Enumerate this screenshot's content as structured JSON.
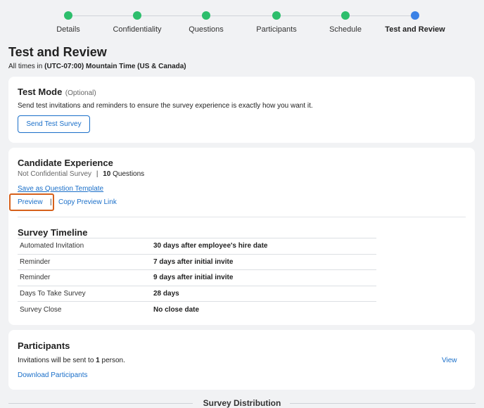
{
  "stepper": {
    "steps": [
      {
        "label": "Details",
        "state": "complete"
      },
      {
        "label": "Confidentiality",
        "state": "complete"
      },
      {
        "label": "Questions",
        "state": "complete"
      },
      {
        "label": "Participants",
        "state": "complete"
      },
      {
        "label": "Schedule",
        "state": "complete"
      },
      {
        "label": "Test and Review",
        "state": "active"
      }
    ]
  },
  "header": {
    "title": "Test and Review",
    "timezone_prefix": "All times in",
    "timezone_value": "(UTC-07:00) Mountain Time (US & Canada)"
  },
  "test_mode": {
    "title": "Test Mode",
    "optional": "(Optional)",
    "description": "Send test invitations and reminders to ensure the survey experience is exactly how you want it.",
    "button": "Send Test Survey"
  },
  "candidate_experience": {
    "title": "Candidate Experience",
    "confidentiality": "Not Confidential Survey",
    "separator": "|",
    "question_count": "10",
    "question_word": "Questions",
    "save_template_link": "Save as Question Template",
    "preview_link": "Preview",
    "link_separator": "|",
    "copy_preview_link": "Copy Preview Link"
  },
  "survey_timeline": {
    "title": "Survey Timeline",
    "rows": [
      {
        "label": "Automated Invitation",
        "value": "30 days after employee's hire date"
      },
      {
        "label": "Reminder",
        "value": "7 days after initial invite"
      },
      {
        "label": "Reminder",
        "value": "9 days after initial invite"
      },
      {
        "label": "Days To Take Survey",
        "value": "28 days"
      },
      {
        "label": "Survey Close",
        "value": "No close date"
      }
    ]
  },
  "participants": {
    "title": "Participants",
    "text_prefix": "Invitations will be sent to",
    "count": "1",
    "text_suffix": "person.",
    "view_link": "View",
    "download_link": "Download Participants"
  },
  "distribution": {
    "title": "Survey Distribution"
  },
  "colors": {
    "complete": "#2dbe6c",
    "active": "#3b82e6",
    "link": "#1a6fc9",
    "highlight": "#d6601b"
  }
}
